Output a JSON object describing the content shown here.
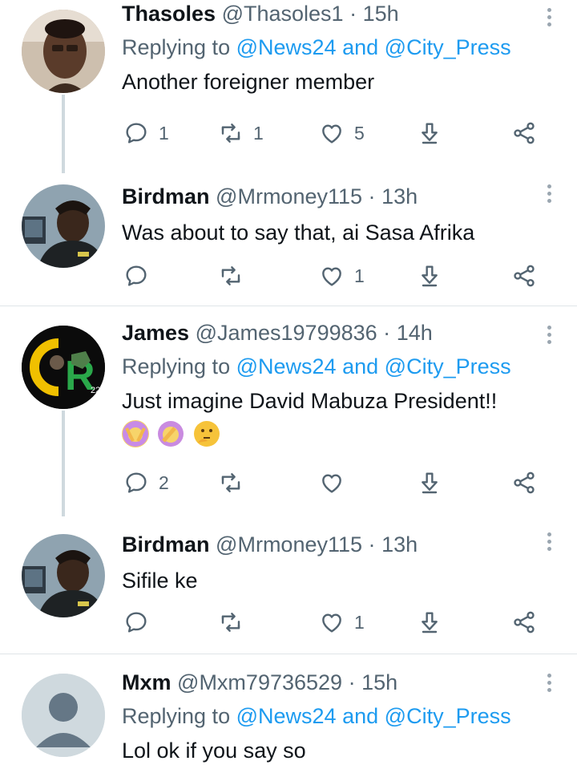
{
  "tweets": [
    {
      "name": "Thasoles",
      "handle": "@Thasoles1",
      "dot": "·",
      "time": "15h",
      "reply_prefix": "Replying to",
      "reply_to_1": "@News24",
      "reply_and": "and",
      "reply_to_2": "@City_Press",
      "text": "Another foreigner member",
      "replies": "1",
      "retweets": "1",
      "likes": "5"
    },
    {
      "name": "Birdman",
      "handle": "@Mrmoney115",
      "dot": "·",
      "time": "13h",
      "text": "Was about to say that, ai Sasa Afrika",
      "replies": "",
      "retweets": "",
      "likes": "1"
    },
    {
      "name": "James",
      "handle": "@James19799836",
      "dot": "·",
      "time": "14h",
      "reply_prefix": "Replying to",
      "reply_to_1": "@News24",
      "reply_and": "and",
      "reply_to_2": "@City_Press",
      "text": "Just imagine David Mabuza President!!",
      "emojis": [
        "person-gesturing-no",
        "person-facepalming",
        "thinking-face"
      ],
      "replies": "2",
      "retweets": "",
      "likes": "",
      "avatar_letters": "CR",
      "avatar_small": "22"
    },
    {
      "name": "Birdman",
      "handle": "@Mrmoney115",
      "dot": "·",
      "time": "13h",
      "text": "Sifile ke",
      "replies": "",
      "retweets": "",
      "likes": "1"
    },
    {
      "name": "Mxm",
      "handle": "@Mxm79736529",
      "dot": "·",
      "time": "15h",
      "reply_prefix": "Replying to",
      "reply_to_1": "@News24",
      "reply_and": "and",
      "reply_to_2": "@City_Press",
      "text": "Lol ok if you say so"
    }
  ],
  "icons": {
    "reply": "reply-icon",
    "retweet": "retweet-icon",
    "like": "heart-icon",
    "bookmark": "bookmark-arrow-icon",
    "share": "share-icon",
    "more": "more-icon"
  },
  "colors": {
    "link": "#1d9bf0",
    "muted": "#536471",
    "thread_line": "#cfd9de"
  }
}
